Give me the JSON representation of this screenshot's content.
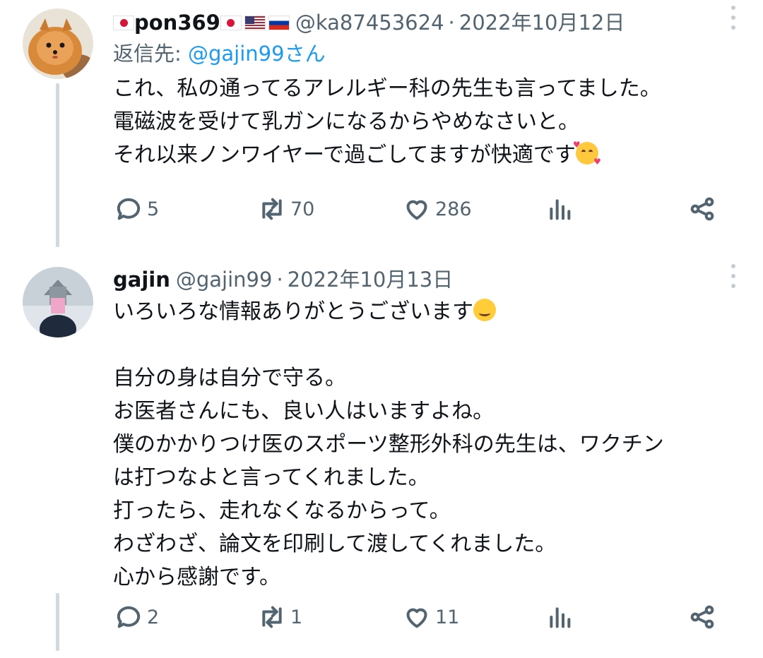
{
  "tweets": [
    {
      "display_name": "pon369",
      "name_flags": [
        "jp",
        "jp",
        "us",
        "ru"
      ],
      "handle": "@ka87453624",
      "separator": "·",
      "date": "2022年10月12日",
      "reply_prefix": "返信先: ",
      "reply_mention": "@gajin99さん",
      "lines": [
        "これ、私の通ってるアレルギー科の先生も言ってました。",
        "電磁波を受けて乳ガンになるからやめなさいと。",
        "それ以来ノンワイヤーで過ごしてますが快適です"
      ],
      "trailing_emoji": "smiling-face-with-hearts",
      "replies": "5",
      "retweets": "70",
      "likes": "286"
    },
    {
      "display_name": "gajin",
      "handle": "@gajin99",
      "separator": "·",
      "date": "2022年10月13日",
      "lines": [
        "いろいろな情報ありがとうございます",
        "",
        "自分の身は自分で守る。",
        "お医者さんにも、良い人はいますよね。",
        "僕のかかりつけ医のスポーツ整形外科の先生は、ワクチン",
        "は打つなよと言ってくれました。",
        "打ったら、走れなくなるからって。",
        "わざわざ、論文を印刷して渡してくれました。",
        "心から感謝です。"
      ],
      "first_line_emoji": "smiling-face",
      "replies": "2",
      "retweets": "1",
      "likes": "11"
    }
  ],
  "colors": {
    "text": "#0f1419",
    "secondary": "#536471",
    "link": "#1d9bf0",
    "thread_line": "#cfd9de"
  },
  "icons": [
    "reply-icon",
    "retweet-icon",
    "like-icon",
    "views-icon",
    "share-icon",
    "more-icon"
  ]
}
